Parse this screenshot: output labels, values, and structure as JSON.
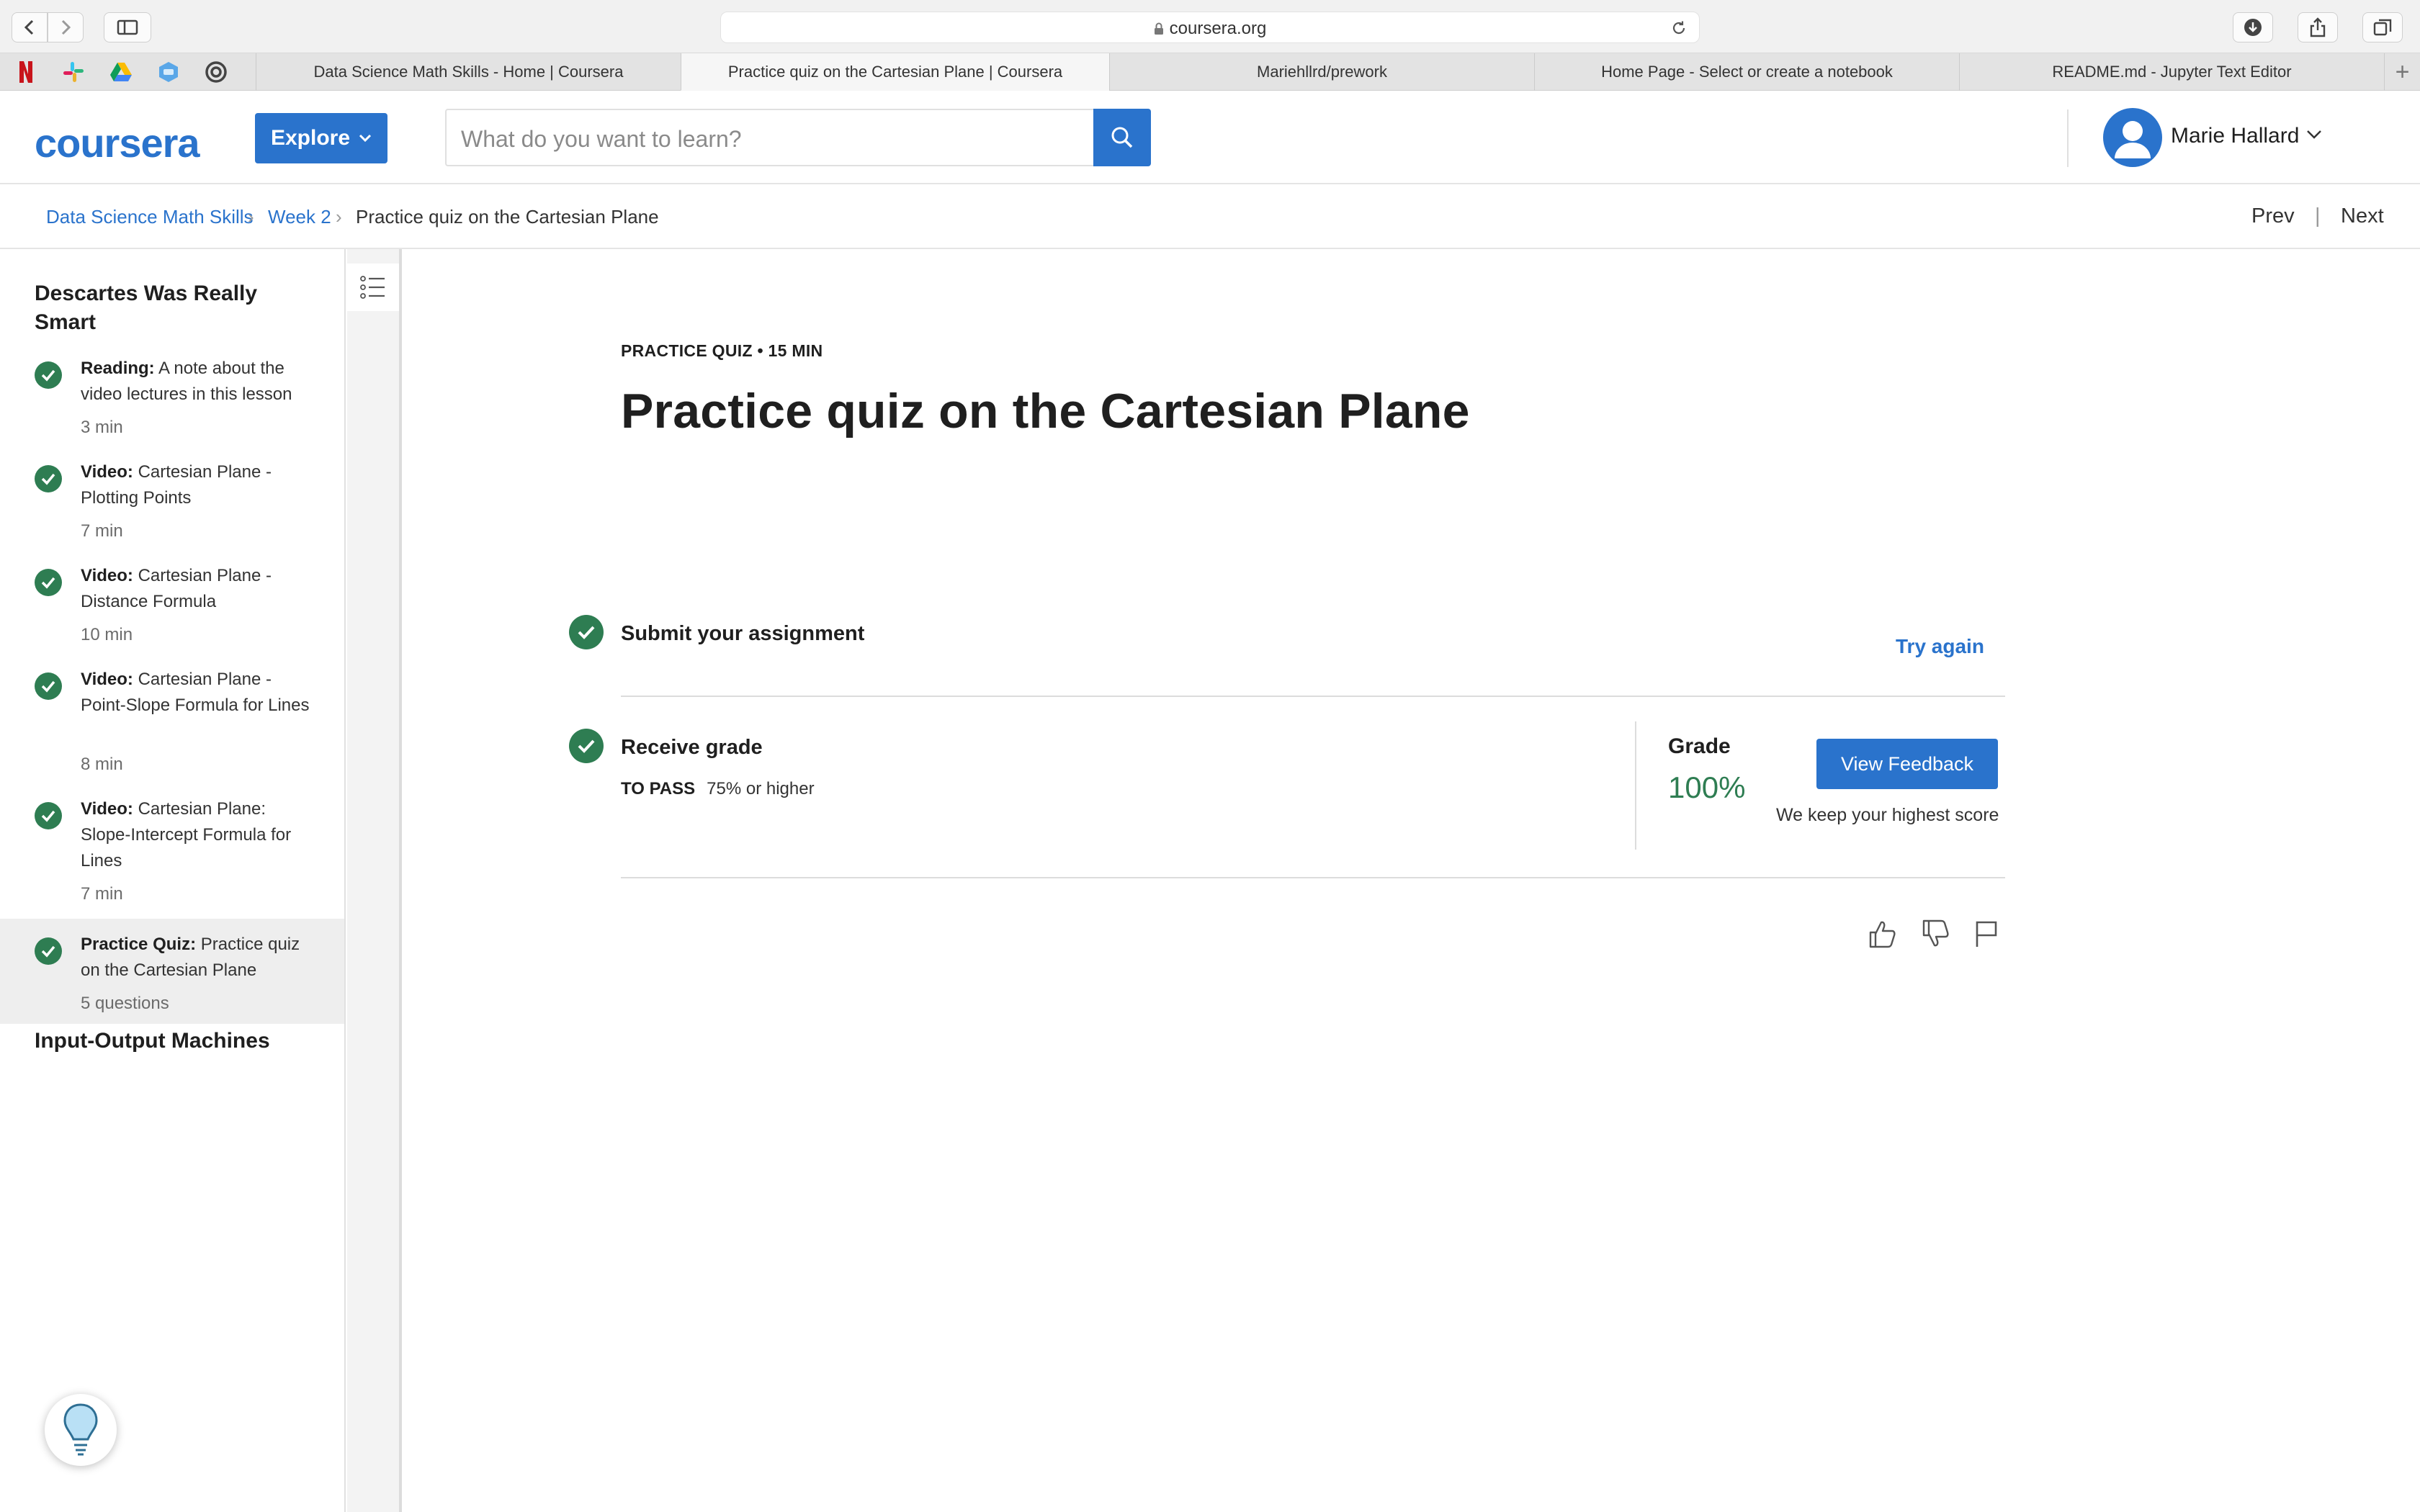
{
  "browser": {
    "url": "coursera.org",
    "tabs": [
      {
        "label": "Data Science Math Skills - Home | Coursera"
      },
      {
        "label": "Practice quiz on the Cartesian Plane | Coursera"
      },
      {
        "label": "Mariehllrd/prework"
      },
      {
        "label": "Home Page - Select or create a notebook"
      },
      {
        "label": "README.md - Jupyter Text Editor"
      }
    ],
    "new_tab_label": "+"
  },
  "header": {
    "logo": "coursera",
    "explore_label": "Explore",
    "search_placeholder": "What do you want to learn?",
    "user_name": "Marie Hallard"
  },
  "breadcrumb": {
    "items": [
      "Data Science Math Skills",
      "Week 2",
      "Practice quiz on the Cartesian Plane"
    ],
    "prev": "Prev",
    "next": "Next"
  },
  "sidebar": {
    "module_title": "Descartes Was Really Smart",
    "items": [
      {
        "type": "Reading:",
        "title": "A note about the video lectures in this lesson",
        "meta": "3 min"
      },
      {
        "type": "Video:",
        "title": "Cartesian Plane - Plotting Points",
        "meta": "7 min"
      },
      {
        "type": "Video:",
        "title": "Cartesian Plane - Distance Formula",
        "meta": "10 min"
      },
      {
        "type": "Video:",
        "title": "Cartesian Plane - Point-Slope Formula for Lines",
        "meta": "8 min"
      },
      {
        "type": "Video:",
        "title": "Cartesian Plane: Slope-Intercept Formula for Lines",
        "meta": "7 min"
      },
      {
        "type": "Practice Quiz:",
        "title": "Practice quiz on the Cartesian Plane",
        "meta": "5 questions"
      }
    ],
    "next_module_title": "Input-Output Machines"
  },
  "main": {
    "kicker": "PRACTICE QUIZ • 15 MIN",
    "title": "Practice quiz on the Cartesian Plane",
    "submit_label": "Submit your assignment",
    "try_again": "Try again",
    "receive_label": "Receive grade",
    "to_pass_label": "TO PASS",
    "to_pass_value": "75% or higher",
    "grade_label": "Grade",
    "grade_value": "100%",
    "view_feedback": "View Feedback",
    "keep_note": "We keep your highest score"
  },
  "colors": {
    "brand_blue": "#2a73cc",
    "success_green": "#2e7d52"
  }
}
